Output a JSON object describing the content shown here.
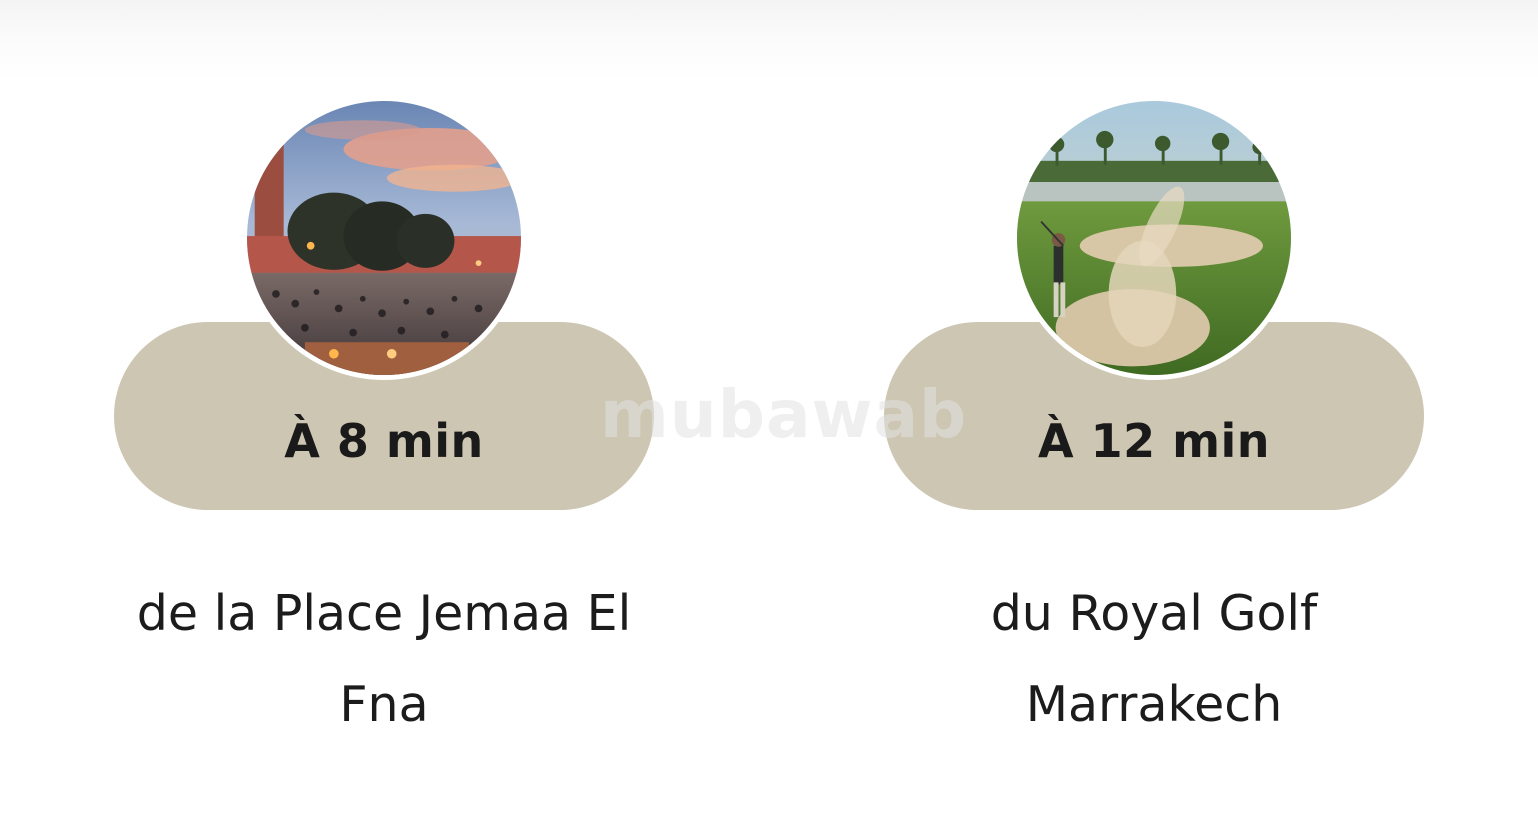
{
  "watermark": "mubawab",
  "cards": [
    {
      "time_label": "À 8 min",
      "caption_line1": "de la Place Jemaa El",
      "caption_line2": "Fna",
      "image_subject": "jemaa-el-fna-square-photo"
    },
    {
      "time_label": "À 12 min",
      "caption_line1": "du Royal Golf",
      "caption_line2": "Marrakech",
      "image_subject": "royal-golf-marrakech-photo"
    }
  ],
  "colors": {
    "pill": "#cdc6b2",
    "text": "#1c1c1c",
    "background": "#ffffff"
  }
}
